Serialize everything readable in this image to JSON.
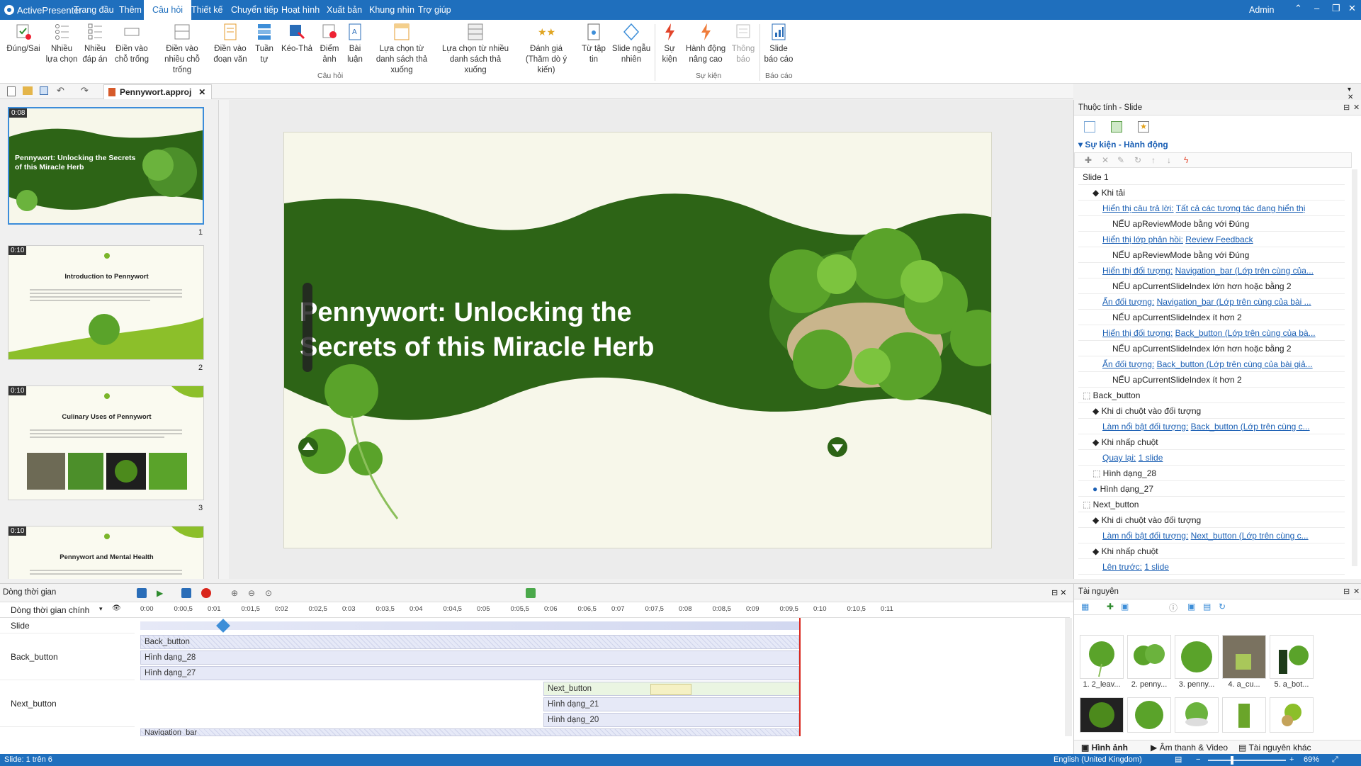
{
  "app": {
    "name": "ActivePresenter",
    "user": "Admin"
  },
  "menu": [
    "Trang đầu",
    "Thêm",
    "Câu hỏi",
    "Thiết kế",
    "Chuyển tiếp",
    "Hoạt hình",
    "Xuất bản",
    "Khung nhìn",
    "Trợ giúp"
  ],
  "menu_active_index": 2,
  "ribbon": {
    "buttons": [
      {
        "label": "Đúng/Sai",
        "icon": "true-false-icon"
      },
      {
        "label": "Nhiều lựa chọn",
        "icon": "multiple-choice-icon"
      },
      {
        "label": "Nhiều đáp án",
        "icon": "multiple-response-icon"
      },
      {
        "label": "Điền vào chỗ trống",
        "icon": "fill-blank-icon"
      },
      {
        "label": "Điền vào nhiều chỗ trống",
        "icon": "fill-multiple-blanks-icon"
      },
      {
        "label": "Điền vào đoạn văn",
        "icon": "fill-paragraph-icon"
      },
      {
        "label": "Tuần tự",
        "icon": "sequence-icon"
      },
      {
        "label": "Kéo-Thả",
        "icon": "drag-drop-icon"
      },
      {
        "label": "Điểm ảnh",
        "icon": "hotspot-icon"
      },
      {
        "label": "Bài luận",
        "icon": "essay-icon"
      },
      {
        "label": "Lựa chọn từ danh sách thả xuống",
        "icon": "dropdown-select-icon"
      },
      {
        "label": "Lựa chọn từ nhiều danh sách thả xuống",
        "icon": "multi-dropdown-icon"
      },
      {
        "label": "Đánh giá (Thăm dò ý kiến)",
        "icon": "rating-icon"
      },
      {
        "label": "Từ tập tin",
        "icon": "from-file-icon"
      },
      {
        "label": "Slide ngẫu nhiên",
        "icon": "random-slide-icon"
      },
      {
        "label": "Sự kiện",
        "icon": "event-icon"
      },
      {
        "label": "Hành động nâng cao",
        "icon": "advanced-action-icon"
      },
      {
        "label": "Thông báo",
        "icon": "message-icon"
      },
      {
        "label": "Slide báo cáo",
        "icon": "report-slide-icon"
      }
    ],
    "groups": [
      "Câu hỏi",
      "Sự kiện",
      "Báo cáo"
    ]
  },
  "document": {
    "filename": "Pennywort.approj"
  },
  "slides": [
    {
      "num": "1",
      "duration": "0:08",
      "title": "Pennywort: Unlocking the Secrets of this Miracle Herb"
    },
    {
      "num": "2",
      "duration": "0:10",
      "title": "Introduction to Pennywort"
    },
    {
      "num": "3",
      "duration": "0:10",
      "title": "Culinary Uses of Pennywort"
    },
    {
      "num": "",
      "duration": "0:10",
      "title": "Pennywort and Mental Health"
    }
  ],
  "canvas": {
    "title": "Pennywort: Unlocking the Secrets of this Miracle Herb"
  },
  "properties": {
    "panel_title": "Thuộc tính - Slide",
    "section": "Sự kiện - Hành động",
    "rows": [
      {
        "indent": 0,
        "kind": "plain",
        "text": "Slide 1"
      },
      {
        "indent": 1,
        "kind": "event",
        "text": "Khi tải"
      },
      {
        "indent": 2,
        "kind": "action",
        "text": "Hiển thị câu trả lời:",
        "link": "Tất cả các tương tác đang hiển thị"
      },
      {
        "indent": 3,
        "kind": "cond",
        "text": "NẾU apReviewMode bằng với Đúng"
      },
      {
        "indent": 2,
        "kind": "action",
        "text": "Hiển thị lớp phản hồi:",
        "link": "Review Feedback"
      },
      {
        "indent": 3,
        "kind": "cond",
        "text": "NẾU apReviewMode bằng với Đúng"
      },
      {
        "indent": 2,
        "kind": "action",
        "text": "Hiển thị đối tượng:",
        "link": "Navigation_bar (Lớp trên cùng của..."
      },
      {
        "indent": 3,
        "kind": "cond",
        "text": "NẾU apCurrentSlideIndex lớn hơn hoặc bằng 2"
      },
      {
        "indent": 2,
        "kind": "action",
        "text": "Ẩn đối tượng:",
        "link": "Navigation_bar (Lớp trên cùng của bài ..."
      },
      {
        "indent": 3,
        "kind": "cond",
        "text": "NẾU apCurrentSlideIndex ít hơn 2"
      },
      {
        "indent": 2,
        "kind": "action",
        "text": "Hiển thị đối tượng:",
        "link": "Back_button (Lớp trên cùng của bà..."
      },
      {
        "indent": 3,
        "kind": "cond",
        "text": "NẾU apCurrentSlideIndex lớn hơn hoặc bằng 2"
      },
      {
        "indent": 2,
        "kind": "action",
        "text": "Ẩn đối tượng:",
        "link": "Back_button (Lớp trên cùng của bài giả..."
      },
      {
        "indent": 3,
        "kind": "cond",
        "text": "NẾU apCurrentSlideIndex ít hơn 2"
      },
      {
        "indent": 0,
        "kind": "object",
        "text": "Back_button"
      },
      {
        "indent": 1,
        "kind": "event",
        "text": "Khi di chuột vào đối tượng"
      },
      {
        "indent": 2,
        "kind": "action",
        "text": "Làm nổi bật đối tượng:",
        "link": "Back_button (Lớp trên cùng c..."
      },
      {
        "indent": 1,
        "kind": "event",
        "text": "Khi nhấp chuột"
      },
      {
        "indent": 2,
        "kind": "action",
        "text": "Quay lại:",
        "link": "1 slide"
      },
      {
        "indent": 1,
        "kind": "shape",
        "text": "Hình dạng_28"
      },
      {
        "indent": 1,
        "kind": "circle",
        "text": "Hình dạng_27"
      },
      {
        "indent": 0,
        "kind": "object",
        "text": "Next_button"
      },
      {
        "indent": 1,
        "kind": "event",
        "text": "Khi di chuột vào đối tượng"
      },
      {
        "indent": 2,
        "kind": "action",
        "text": "Làm nổi bật đối tượng:",
        "link": "Next_button (Lớp trên cùng c..."
      },
      {
        "indent": 1,
        "kind": "event",
        "text": "Khi nhấp chuột"
      },
      {
        "indent": 2,
        "kind": "action",
        "text": "Lên trước:",
        "link": "1 slide"
      }
    ]
  },
  "timeline": {
    "title": "Dòng thời gian",
    "main_timeline": "Dòng thời gian chính",
    "ticks": [
      "0:00",
      "0:00,5",
      "0:01",
      "0:01,5",
      "0:02",
      "0:02,5",
      "0:03",
      "0:03,5",
      "0:04",
      "0:04,5",
      "0:05",
      "0:05,5",
      "0:06",
      "0:06,5",
      "0:07",
      "0:07,5",
      "0:08",
      "0:08,5",
      "0:09",
      "0:09,5",
      "0:10",
      "0:10,5",
      "0:11"
    ],
    "rows": {
      "slide": "Slide",
      "back": "Back_button",
      "next": "Next_button"
    },
    "bars": {
      "back_button": "Back_button",
      "shape28": "Hình dạng_28",
      "shape27": "Hình dạng_27",
      "next_button": "Next_button",
      "shape21": "Hình dạng_21",
      "shape20": "Hình dạng_20",
      "navbar": "Navigation_bar"
    }
  },
  "resources": {
    "title": "Tài nguyên",
    "items": [
      "1. 2_leav...",
      "2. penny...",
      "3. penny...",
      "4. a_cu...",
      "5. a_bot..."
    ],
    "tabs": [
      "Hình ảnh",
      "Âm thanh & Video",
      "Tài nguyên khác"
    ]
  },
  "status": {
    "slide": "Slide: 1 trên 6",
    "language": "English (United Kingdom)",
    "zoom": "69%"
  },
  "colors": {
    "brand": "#1f6fbd",
    "slide_green": "#2d6416",
    "link": "#1a5fb4"
  }
}
